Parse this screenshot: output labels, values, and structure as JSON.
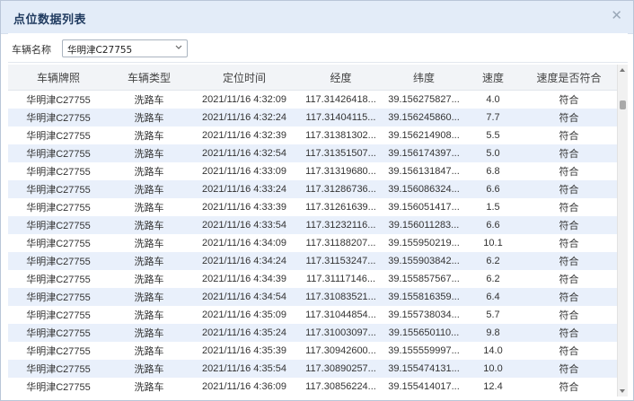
{
  "dialog": {
    "title": "点位数据列表",
    "close_icon": "close-icon"
  },
  "filter": {
    "label": "车辆名称",
    "vehicle_selected": "华明津C27755"
  },
  "table": {
    "headers": [
      "车辆牌照",
      "车辆类型",
      "定位时间",
      "经度",
      "纬度",
      "速度",
      "速度是否符合"
    ],
    "rows": [
      [
        "华明津C27755",
        "洗路车",
        "2021/11/16 4:32:09",
        "117.31426418...",
        "39.156275827...",
        "4.0",
        "符合"
      ],
      [
        "华明津C27755",
        "洗路车",
        "2021/11/16 4:32:24",
        "117.31404115...",
        "39.156245860...",
        "7.7",
        "符合"
      ],
      [
        "华明津C27755",
        "洗路车",
        "2021/11/16 4:32:39",
        "117.31381302...",
        "39.156214908...",
        "5.5",
        "符合"
      ],
      [
        "华明津C27755",
        "洗路车",
        "2021/11/16 4:32:54",
        "117.31351507...",
        "39.156174397...",
        "5.0",
        "符合"
      ],
      [
        "华明津C27755",
        "洗路车",
        "2021/11/16 4:33:09",
        "117.31319680...",
        "39.156131847...",
        "6.8",
        "符合"
      ],
      [
        "华明津C27755",
        "洗路车",
        "2021/11/16 4:33:24",
        "117.31286736...",
        "39.156086324...",
        "6.6",
        "符合"
      ],
      [
        "华明津C27755",
        "洗路车",
        "2021/11/16 4:33:39",
        "117.31261639...",
        "39.156051417...",
        "1.5",
        "符合"
      ],
      [
        "华明津C27755",
        "洗路车",
        "2021/11/16 4:33:54",
        "117.31232116...",
        "39.156011283...",
        "6.6",
        "符合"
      ],
      [
        "华明津C27755",
        "洗路车",
        "2021/11/16 4:34:09",
        "117.31188207...",
        "39.155950219...",
        "10.1",
        "符合"
      ],
      [
        "华明津C27755",
        "洗路车",
        "2021/11/16 4:34:24",
        "117.31153247...",
        "39.155903842...",
        "6.2",
        "符合"
      ],
      [
        "华明津C27755",
        "洗路车",
        "2021/11/16 4:34:39",
        "117.31117146...",
        "39.155857567...",
        "6.2",
        "符合"
      ],
      [
        "华明津C27755",
        "洗路车",
        "2021/11/16 4:34:54",
        "117.31083521...",
        "39.155816359...",
        "6.4",
        "符合"
      ],
      [
        "华明津C27755",
        "洗路车",
        "2021/11/16 4:35:09",
        "117.31044854...",
        "39.155738034...",
        "5.7",
        "符合"
      ],
      [
        "华明津C27755",
        "洗路车",
        "2021/11/16 4:35:24",
        "117.31003097...",
        "39.155650110...",
        "9.8",
        "符合"
      ],
      [
        "华明津C27755",
        "洗路车",
        "2021/11/16 4:35:39",
        "117.30942600...",
        "39.155559997...",
        "14.0",
        "符合"
      ],
      [
        "华明津C27755",
        "洗路车",
        "2021/11/16 4:35:54",
        "117.30890257...",
        "39.155474131...",
        "10.0",
        "符合"
      ],
      [
        "华明津C27755",
        "洗路车",
        "2021/11/16 4:36:09",
        "117.30856224...",
        "39.155414017...",
        "12.4",
        "符合"
      ]
    ]
  }
}
